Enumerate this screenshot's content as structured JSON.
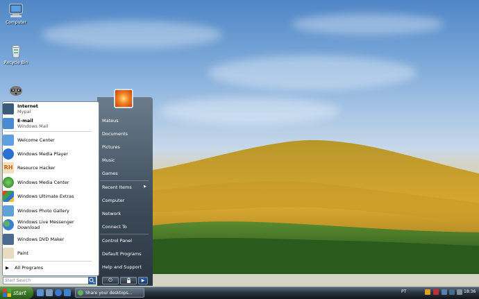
{
  "desktop": {
    "icons": [
      {
        "label": "Computer",
        "icon": "computer-icon"
      },
      {
        "label": "Recycle Bin",
        "icon": "recycle-bin-icon"
      },
      {
        "label": "",
        "icon": "raccoon-icon"
      }
    ]
  },
  "start_menu": {
    "pinned": [
      {
        "title": "Internet",
        "subtitle": "Mypal",
        "icon": "mypal-icon",
        "color": "#3a5c7a"
      },
      {
        "title": "E-mail",
        "subtitle": "Windows Mail",
        "icon": "mail-icon",
        "color": "#4a8ad0"
      }
    ],
    "recent": [
      {
        "label": "Welcome Center",
        "icon": "welcome-center-icon",
        "color": "#5fa0e0"
      },
      {
        "label": "Windows Media Player",
        "icon": "media-player-icon",
        "color": "#2a70d0"
      },
      {
        "label": "Resource Hacker",
        "icon": "resource-hacker-icon",
        "color": "#d06010"
      },
      {
        "label": "Windows Media Center",
        "icon": "media-center-icon",
        "color": "#3a9a30"
      },
      {
        "label": "Windows Ultimate Extras",
        "icon": "ultimate-extras-icon",
        "color": "#3a70c0"
      },
      {
        "label": "Windows Photo Gallery",
        "icon": "photo-gallery-icon",
        "color": "#60a0d8"
      },
      {
        "label": "Windows Live Messenger Download",
        "icon": "messenger-icon",
        "color": "#50a060"
      },
      {
        "label": "Windows DVD Maker",
        "icon": "dvd-maker-icon",
        "color": "#4a6a90"
      },
      {
        "label": "Paint",
        "icon": "paint-icon",
        "color": "#c0a070"
      }
    ],
    "all_programs": "All Programs",
    "search_placeholder": "Start Search",
    "right_items": [
      "Mateus",
      "Documents",
      "Pictures",
      "Music",
      "Games",
      "Recent Items",
      "Computer",
      "Network",
      "Connect To",
      "Control Panel",
      "Default Programs",
      "Help and Support"
    ]
  },
  "taskbar": {
    "start_label": "start",
    "task_label": "Share your desktops...",
    "language": "PT",
    "clock": "18:36"
  }
}
